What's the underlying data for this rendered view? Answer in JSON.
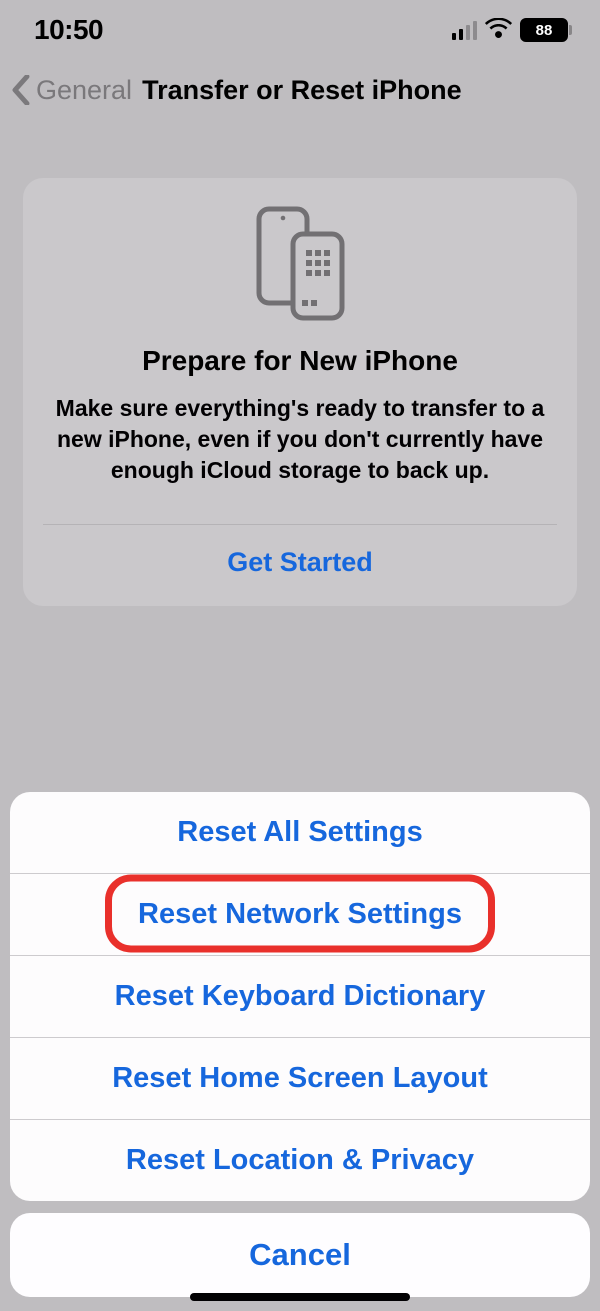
{
  "status": {
    "time": "10:50",
    "battery_pct": "88"
  },
  "nav": {
    "back_label": "General",
    "title": "Transfer or Reset iPhone"
  },
  "card": {
    "title": "Prepare for New iPhone",
    "body": "Make sure everything's ready to transfer to a new iPhone, even if you don't currently have enough iCloud storage to back up.",
    "action": "Get Started"
  },
  "sheet": {
    "items": [
      "Reset All Settings",
      "Reset Network Settings",
      "Reset Keyboard Dictionary",
      "Reset Home Screen Layout",
      "Reset Location & Privacy"
    ],
    "cancel": "Cancel",
    "highlight_index": 1
  }
}
